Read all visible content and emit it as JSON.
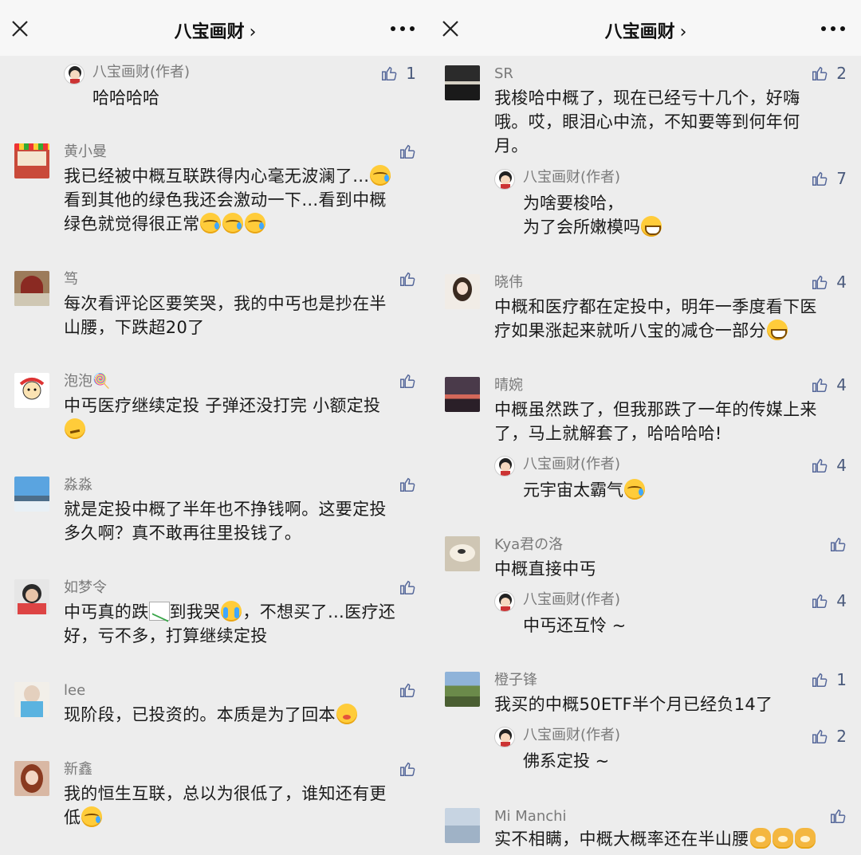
{
  "header": {
    "left_title": "八宝画财",
    "right_title": "八宝画财",
    "chevron": "›"
  },
  "left_comments": [
    {
      "name": "",
      "text": "",
      "likes": ""
    },
    {
      "name": "黄小曼",
      "text": "我已经被中概互联跌得内心毫无波澜了…",
      "text2": "看到其他的绿色我还会激动一下…看到中概",
      "text3": "绿色就觉得很正常",
      "likes": ""
    },
    {
      "name": "笃",
      "text": "每次看评论区要笑哭，我的中丐也是抄在半",
      "text2": "山腰，下跌超20了",
      "likes": ""
    },
    {
      "name": "泡泡🍭",
      "text": "中丐医疗继续定投 子弹还没打完 小额定投",
      "likes": ""
    },
    {
      "name": "淼淼",
      "text": "就是定投中概了半年也不挣钱啊。这要定投",
      "text2": "多久啊？真不敢再往里投钱了。",
      "likes": ""
    },
    {
      "name": "如梦令",
      "text_a": "中丐真的跌",
      "text_b": "到我哭",
      "text_c": "，不想买了…医疗还",
      "text2": "好，亏不多，打算继续定投",
      "likes": ""
    },
    {
      "name": "lee",
      "text": "现阶段，已投资的。本质是为了回本",
      "likes": ""
    },
    {
      "name": "新鑫",
      "text": "我的恒生互联，总以为很低了，谁知还有更",
      "text2": "低",
      "likes": ""
    }
  ],
  "left_top_reply": {
    "name": "八宝画财(作者)",
    "text": "哈哈哈哈",
    "likes": "1"
  },
  "right_comments": [
    {
      "name": "SR",
      "text": "我梭哈中概了，现在已经亏十几个，好嗨",
      "text2": "哦。哎，眼泪心中流，不知要等到何年何",
      "text3": "月。",
      "likes": "2"
    },
    {
      "name": "晓伟",
      "text": "中概和医疗都在定投中，明年一季度看下医",
      "text2": "疗如果涨起来就听八宝的减仓一部分",
      "likes": "4"
    },
    {
      "name": "晴婉",
      "text": "中概虽然跌了，但我那跌了一年的传媒上来",
      "text2": "了，马上就解套了，哈哈哈哈!",
      "likes": "4"
    },
    {
      "name": "Kya君の洛",
      "text": "中概直接中丐",
      "likes": ""
    },
    {
      "name": "橙子锋",
      "text": "我买的中概50ETF半个月已经负14了",
      "likes": "1"
    },
    {
      "name": "Mi Manchi",
      "text": "实不相瞒，中概大概率还在半山腰",
      "likes": ""
    }
  ],
  "right_replies": [
    {
      "name": "八宝画财(作者)",
      "text": "为啥要梭哈，",
      "text2": "为了会所嫩模吗",
      "likes": "7"
    },
    {
      "name": "八宝画财(作者)",
      "text": "元宇宙太霸气",
      "likes": "4"
    },
    {
      "name": "八宝画财(作者)",
      "text": "中丐还互怜 ~",
      "likes": "4"
    },
    {
      "name": "八宝画财(作者)",
      "text": "佛系定投 ~",
      "likes": "2"
    }
  ],
  "icons": {
    "close": "close-icon",
    "more": "more-icon",
    "like": "thumbs-up-icon"
  }
}
